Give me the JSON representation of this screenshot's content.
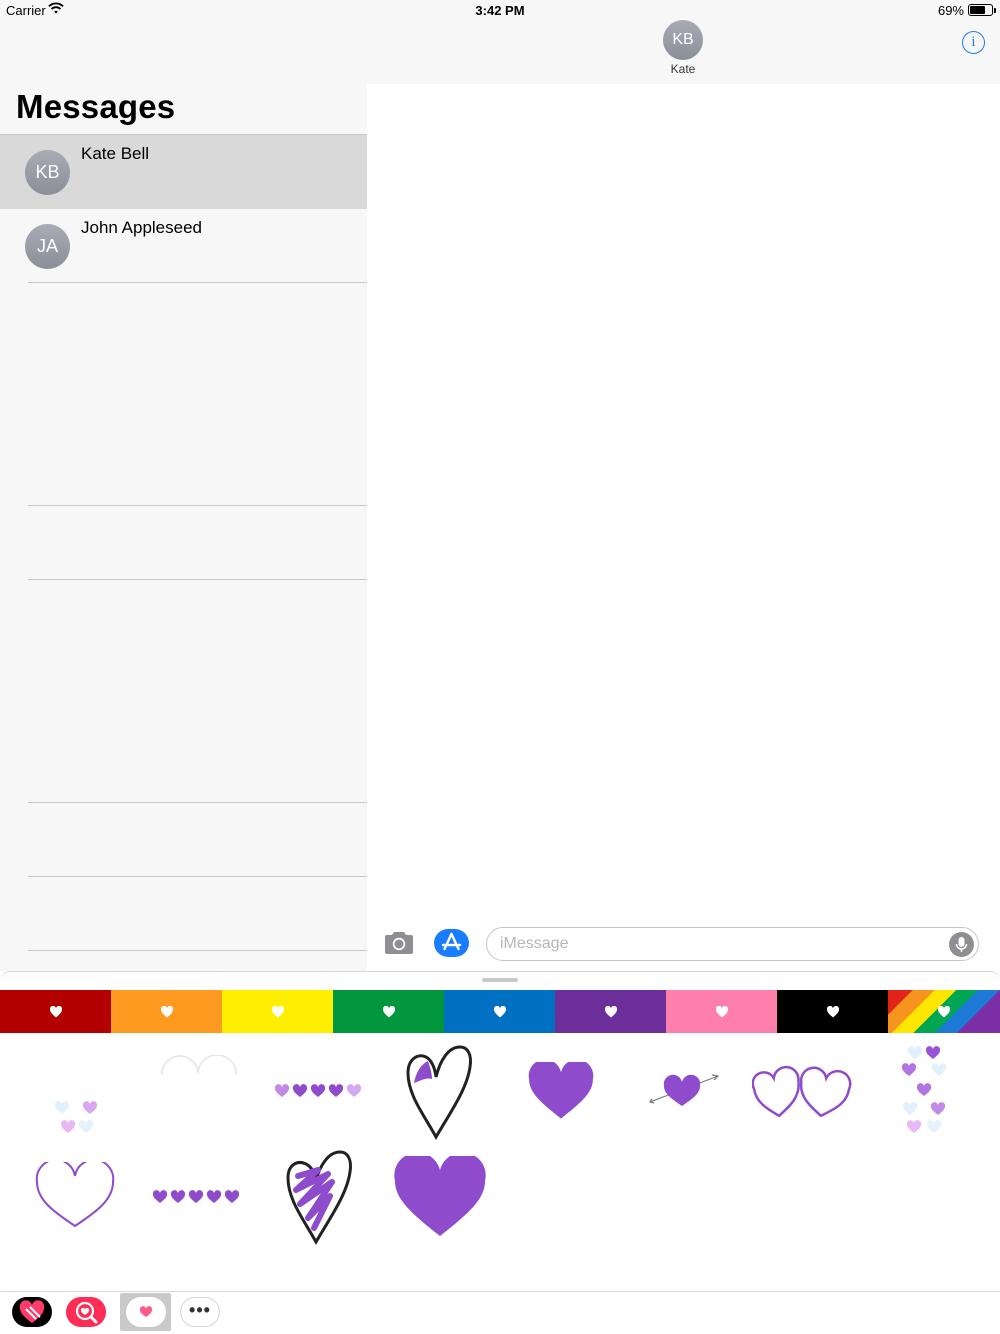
{
  "status_bar": {
    "carrier": "Carrier",
    "time": "3:42 PM",
    "battery": "69%"
  },
  "header": {
    "avatar_initials": "KB",
    "contact_name": "Kate",
    "info_icon": "info-icon"
  },
  "sidebar": {
    "title": "Messages",
    "conversations": [
      {
        "initials": "KB",
        "name": "Kate Bell",
        "selected": true
      },
      {
        "initials": "JA",
        "name": "John Appleseed",
        "selected": false
      }
    ]
  },
  "compose": {
    "placeholder": "iMessage",
    "camera_icon": "camera-icon",
    "apps_icon": "appstore-icon",
    "mic_icon": "mic-icon"
  },
  "sticker_drawer": {
    "color_tabs": [
      {
        "name": "red",
        "color": "#b20000"
      },
      {
        "name": "orange",
        "color": "#ff9a21"
      },
      {
        "name": "yellow",
        "color": "#ffee00"
      },
      {
        "name": "green",
        "color": "#00963d"
      },
      {
        "name": "blue",
        "color": "#0071c2"
      },
      {
        "name": "purple",
        "color": "#6c2f99"
      },
      {
        "name": "pink",
        "color": "#ff7fac"
      },
      {
        "name": "black",
        "color": "#000000"
      },
      {
        "name": "rainbow",
        "color": "#rainbow"
      }
    ],
    "accent_color": "#8e4bcc",
    "stickers_row1": [
      "scattered-light-hearts",
      "outline-arcs",
      "heart-row-light",
      "scribble-heart-outline",
      "solid-purple-heart",
      "heart-with-arrow",
      "two-linked-hearts",
      "heart-column"
    ],
    "stickers_row2": [
      "outline-purple-heart",
      "heart-row-dark",
      "scribble-filled-heart",
      "large-solid-heart"
    ]
  },
  "app_strip": {
    "apps": [
      "heart-app-icon",
      "search-heart-app-icon",
      "current-sticker-app",
      "more-apps-icon"
    ]
  }
}
